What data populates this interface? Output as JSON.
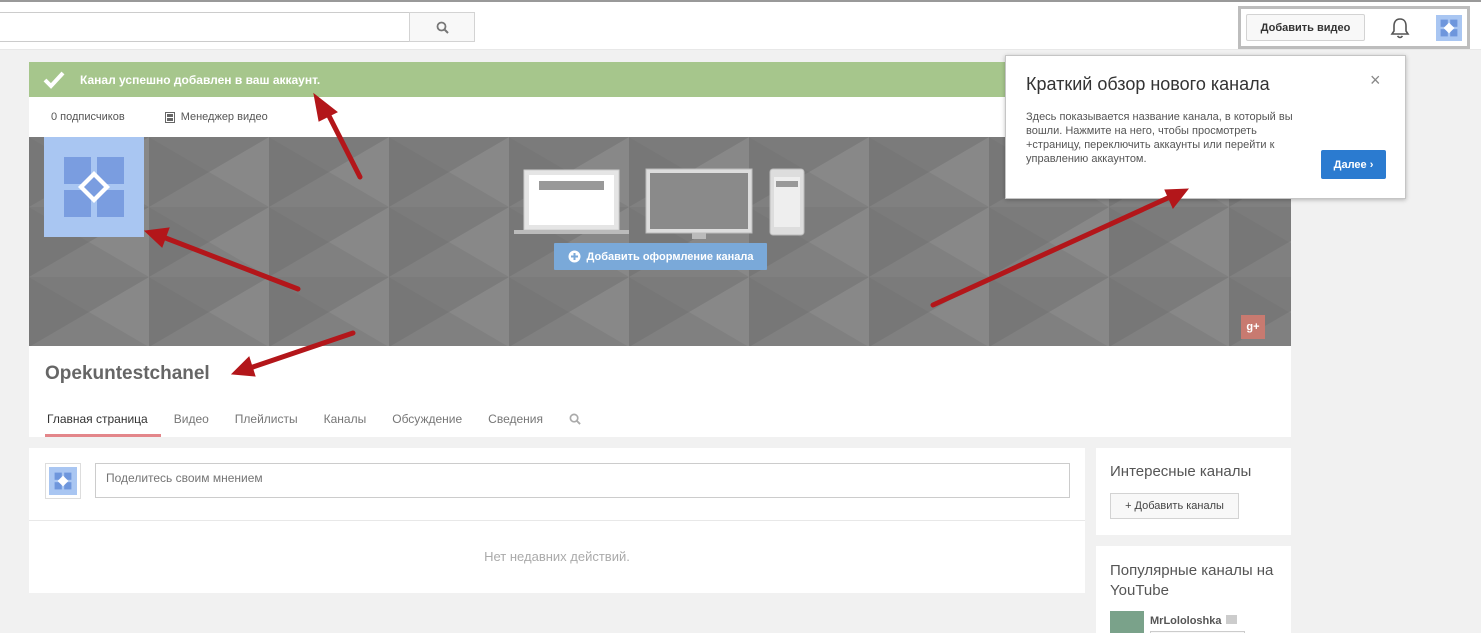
{
  "header": {
    "search_placeholder": "",
    "upload_label": "Добавить видео"
  },
  "channel": {
    "success_message": "Канал успешно добавлен в ваш аккаунт.",
    "subscribers": "0 подписчиков",
    "video_manager": "Менеджер видео",
    "add_art_label": "Добавить оформление канала",
    "gplus_label": "g+",
    "title": "Opekuntestchanel",
    "tabs": [
      "Главная страница",
      "Видео",
      "Плейлисты",
      "Каналы",
      "Обсуждение",
      "Сведения"
    ]
  },
  "feed": {
    "placeholder": "Поделитесь своим мнением",
    "empty": "Нет недавних действий."
  },
  "sidebar": {
    "interesting_title": "Интересные каналы",
    "add_channels_label": "+ Добавить каналы",
    "popular_title": "Популярные каналы на YouTube",
    "popular_item_name": "MrLololoshka"
  },
  "popup": {
    "title": "Краткий обзор нового канала",
    "close_label": "×",
    "body": "Здесь показывается название канала, в который вы вошли. Нажмите на него, чтобы просмотреть +страницу, переключить аккаунты или перейти к управлению аккаунтом.",
    "next_label": "Далее ›"
  },
  "colors": {
    "success_green": "#a6c68c",
    "accent_blue": "#2b7bd0",
    "avatar_blue": "#a9c6f2",
    "annotation_arrow": "#b3161a",
    "active_tab": "#e3868a"
  }
}
